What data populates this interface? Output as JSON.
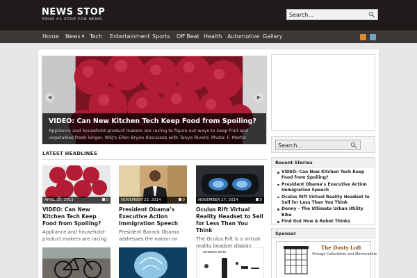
{
  "site": {
    "title": "NEWS STOP",
    "tagline": "YOUR #1 STOP FOR NEWS"
  },
  "search_top": {
    "placeholder": "Search..."
  },
  "nav": {
    "items": [
      "Home",
      "News",
      "Tech",
      "Entertainment",
      "Sports",
      "Off Beat",
      "Health",
      "Automotive",
      "Gallery"
    ],
    "social": [
      "rss-icon",
      "twitter-icon"
    ]
  },
  "slider": {
    "title": "VIDEO: Can New Kitchen Tech Keep Food from Spoiling?",
    "text": "Appliance and household-product makers are racing to figure out ways to keep fruit and vegetables fresh longer. WSJ's Ellen Bryon discusses with Tanya Rivero. Photo: F. Martin Ramin/WSJ",
    "prev_icon": "chevron-left-icon",
    "next_icon": "chevron-right-icon"
  },
  "latest": {
    "heading": "LATEST HEADLINES",
    "cards": [
      {
        "date": "APRIL 25, 2015",
        "comments": "0",
        "title": "VIDEO: Can New Kitchen Tech Keep Food from Spoiling?",
        "excerpt": "Appliance and household-product makers are racing to"
      },
      {
        "date": "NOVEMBER 22, 2014",
        "comments": "0",
        "title": "President Obama’s Executive Action Immigration Speech",
        "excerpt": "President Barack Obama addresses the nation on"
      },
      {
        "date": "NOVEMBER 17, 2014",
        "comments": "0",
        "title": "Oculus Rift Virtual Reality Headset to Sell for Less Than You Think",
        "excerpt": "The Oculus Rift is a virtual reality headset display owned"
      }
    ],
    "more_thumb_label": "amazon echo"
  },
  "sidebar": {
    "search_placeholder": "Search...",
    "recent": {
      "title": "Recent Stories",
      "items": [
        "VIDEO: Can New Kitchen Tech Keep Food from Spoiling?",
        "President Obama’s Executive Action Immigration Speech",
        "Oculus Rift Virtual Reality Headset to Sell for Less Than You Think",
        "Denny – The Ultimate Urban Utility Bike",
        "Find Out How A Robot Thinks"
      ]
    },
    "sponsor": {
      "title": "Sponsor",
      "name": "The Dusty Loft",
      "sub": "Vintage Collectibles and Memorabilia"
    }
  },
  "colors": {
    "header_bg": "#1e1b1a",
    "nav_bg": "#3a3735",
    "raspberry": "#b21c34",
    "rss": "#e2892c",
    "twitter": "#6fa6c8"
  }
}
